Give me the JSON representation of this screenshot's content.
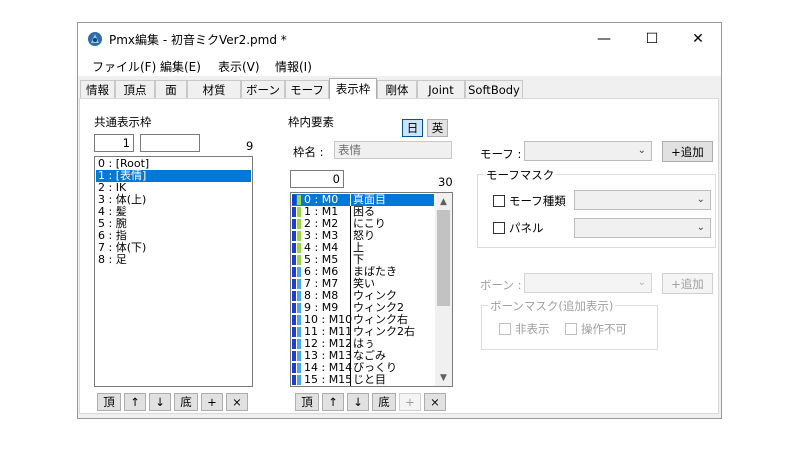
{
  "window": {
    "title": "Pmx編集 - 初音ミクVer2.pmd *"
  },
  "title_buttons": {
    "minimize": "—",
    "maximize": "☐",
    "close": "✕"
  },
  "menu": [
    "ファイル(F)",
    "編集(E)",
    "表示(V)",
    "情報(I)"
  ],
  "tabs": [
    "情報",
    "頂点",
    "面",
    "材質",
    "ボーン",
    "モーフ",
    "表示枠",
    "剛体",
    "Joint",
    "SoftBody"
  ],
  "active_tab": "表示枠",
  "common_frame": {
    "heading": "共通表示枠",
    "index_value": "1",
    "name_value": "",
    "count": "9",
    "items": [
      "0 : [Root]",
      "1 : [表情]",
      "2 : IK",
      "3 : 体(上)",
      "4 : 髪",
      "5 : 腕",
      "6 : 指",
      "7 : 体(下)",
      "8 : 足"
    ],
    "selected_index": 1,
    "buttons": [
      "頂",
      "↑",
      "↓",
      "底",
      "+",
      "×"
    ]
  },
  "frame_elements": {
    "heading": "枠内要素",
    "lang_jp": "日",
    "lang_en": "英",
    "frame_name_label": "枠名 :",
    "frame_name_value": "表情",
    "index_value": "0",
    "count": "30",
    "items": [
      {
        "id": "0 : M0",
        "name": "真面目",
        "color": "#9ed34a"
      },
      {
        "id": "1 : M1",
        "name": "困る",
        "color": "#9ed34a"
      },
      {
        "id": "2 : M2",
        "name": "にこり",
        "color": "#9ed34a"
      },
      {
        "id": "3 : M3",
        "name": "怒り",
        "color": "#9ed34a"
      },
      {
        "id": "4 : M4",
        "name": "上",
        "color": "#9ed34a"
      },
      {
        "id": "5 : M5",
        "name": "下",
        "color": "#9ed34a"
      },
      {
        "id": "6 : M6",
        "name": "まばたき",
        "color": "#4aa8e8"
      },
      {
        "id": "7 : M7",
        "name": "笑い",
        "color": "#4aa8e8"
      },
      {
        "id": "8 : M8",
        "name": "ウィンク",
        "color": "#4aa8e8"
      },
      {
        "id": "9 : M9",
        "name": "ウィンク2",
        "color": "#4aa8e8"
      },
      {
        "id": "10 : M10",
        "name": "ウィンク右",
        "color": "#4aa8e8"
      },
      {
        "id": "11 : M11",
        "name": "ウィンク2右",
        "color": "#4aa8e8"
      },
      {
        "id": "12 : M12",
        "name": "はぅ",
        "color": "#4aa8e8"
      },
      {
        "id": "13 : M13",
        "name": "なごみ",
        "color": "#4aa8e8"
      },
      {
        "id": "14 : M14",
        "name": "びっくり",
        "color": "#4aa8e8"
      },
      {
        "id": "15 : M15",
        "name": "じと目",
        "color": "#4aa8e8"
      }
    ],
    "selected_index": 0,
    "scroll_fraction": 0.0,
    "buttons": [
      "頂",
      "↑",
      "↓",
      "底",
      "+",
      "×"
    ]
  },
  "morph_section": {
    "morph_label": "モーフ :",
    "add_button": "+追加",
    "mask_group": "モーフマスク",
    "type_check": "モーフ種類",
    "panel_check": "パネル"
  },
  "bone_section": {
    "bone_label": "ボーン :",
    "add_button": "+追加",
    "mask_group": "ボーンマスク(追加表示)",
    "hidden_check": "非表示",
    "locked_check": "操作不可"
  },
  "colors": {
    "selection": "#0078d7",
    "expression_swatch": "#9ed34a",
    "eye_swatch": "#4aa8e8",
    "frame_swatch": "#1a3fcf"
  }
}
